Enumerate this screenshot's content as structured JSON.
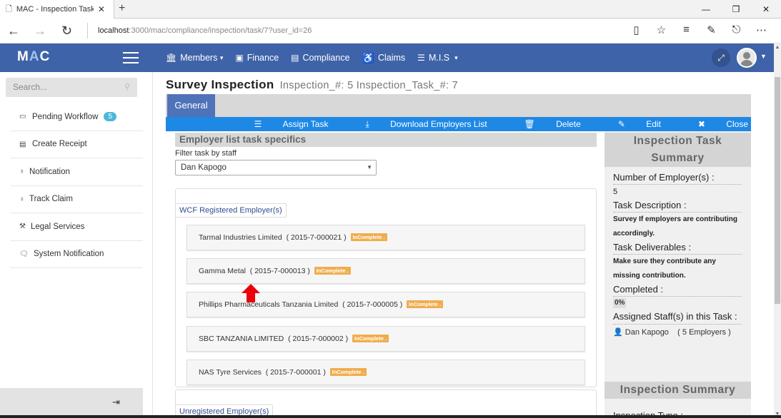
{
  "browser": {
    "tab_title": "MAC - Inspection Task D",
    "new_tab": "+",
    "win_controls": [
      "—",
      "❐",
      "✕"
    ],
    "url_host": "localhost",
    "url_path": ":3000/mac/compliance/inspection/task/7?user_id=26"
  },
  "app": {
    "logo_m": "M",
    "logo_a": "A",
    "logo_c": "C",
    "menu": [
      {
        "icon": "bank-icon",
        "label": "Members",
        "caret": "▾"
      },
      {
        "icon": "money-icon",
        "label": "Finance"
      },
      {
        "icon": "book-icon",
        "label": "Compliance"
      },
      {
        "icon": "wheelchair-icon",
        "label": "Claims"
      },
      {
        "icon": "list-icon",
        "label": "M.I.S",
        "caret": "▾"
      }
    ]
  },
  "sidebar": {
    "search_placeholder": "Search...",
    "items": [
      {
        "label": "Pending Workflow",
        "badge": "5",
        "icon": "inbox-icon"
      },
      {
        "label": "Create Receipt",
        "icon": "list-alt-icon"
      },
      {
        "label": "Notification",
        "icon": "bell-icon"
      },
      {
        "label": "Track Claim",
        "icon": "gavel-icon"
      },
      {
        "label": "Legal Services",
        "icon": "legal-icon"
      },
      {
        "label": "System Notification",
        "icon": "comments-icon"
      }
    ]
  },
  "page": {
    "title": "Survey Inspection",
    "subtitle": "Inspection_#: 5 Inspection_Task_#: 7",
    "tab_general": "General",
    "actions": {
      "assign": "Assign Task",
      "download": "Download Employers List",
      "delete": "Delete",
      "edit": "Edit",
      "close": "Close"
    },
    "section_title": "Employer list task specifics",
    "filter_label": "Filter task by staff",
    "filter_value": "Dan Kapogo",
    "registered_legend": "WCF Registered Employer(s)",
    "unregistered_legend": "Unregistered Employer(s)",
    "employers": [
      {
        "name": "Tarmal Industries Limited",
        "code": "( 2015-7-000021 )",
        "status": "InComplete ."
      },
      {
        "name": "Gamma Metal",
        "code": "( 2015-7-000013 )",
        "status": "InComplete ."
      },
      {
        "name": "Phillips Pharmaceuticals Tanzania Limited",
        "code": "( 2015-7-000005 )",
        "status": "InComplete ."
      },
      {
        "name": "SBC TANZANIA LIMITED",
        "code": "( 2015-7-000002 )",
        "status": "InComplete ."
      },
      {
        "name": "NAS Tyre Services",
        "code": "( 2015-7-000001 )",
        "status": "InComplete ."
      }
    ]
  },
  "summary": {
    "title_line1": "Inspection Task",
    "title_line2": "Summary",
    "num_employers_label": "Number of Employer(s) :",
    "num_employers_value": "5",
    "task_desc_label": "Task Description :",
    "task_desc_value": "Survey If employers are contributing accordingly.",
    "deliverables_label": "Task Deliverables :",
    "deliverables_value": "Make sure they contribute any missing contribution.",
    "completed_label": "Completed :",
    "completed_value": "0%",
    "assigned_label": "Assigned Staff(s) in this Task :",
    "assigned_name": "Dan Kapogo",
    "assigned_count": "( 5 Employers )",
    "insp_summary_title": "Inspection Summary",
    "insp_type_label": "Inspection Type :"
  },
  "colors": {
    "navbar": "#3f63a8",
    "action_bar": "#1e88e5",
    "incomplete_badge": "#f0ad4e",
    "badge": "#4db8d8"
  }
}
